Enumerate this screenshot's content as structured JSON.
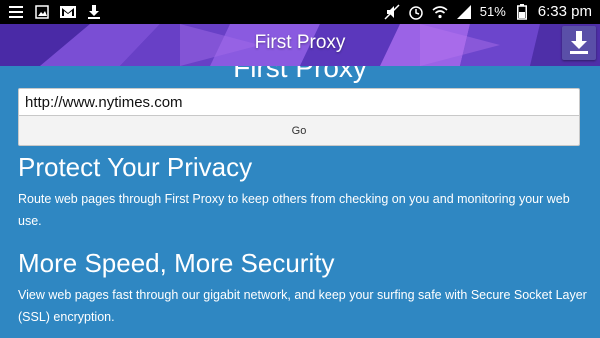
{
  "statusbar": {
    "time": "6:33 pm",
    "battery": "51%",
    "left_icons": [
      "bars-icon",
      "image-icon",
      "gmail-icon",
      "download-icon"
    ],
    "right_icons": [
      "silent-icon",
      "alarm-icon",
      "wifi-icon",
      "signal-icon",
      "battery-icon"
    ]
  },
  "appbar": {
    "title": "First Proxy",
    "accent": "#5a35b8"
  },
  "page": {
    "ghost_title": "First Proxy",
    "url_value": "http://www.nytimes.com",
    "go_label": "Go",
    "sections": [
      {
        "heading": "Protect Your Privacy",
        "body": "Route web pages through First Proxy to keep others from checking on you and monitoring your web use."
      },
      {
        "heading": "More Speed, More Security",
        "body": "View web pages fast through our gigabit network, and keep your surfing safe with Secure Socket Layer (SSL) encryption."
      }
    ],
    "background": "#2f87c2"
  }
}
